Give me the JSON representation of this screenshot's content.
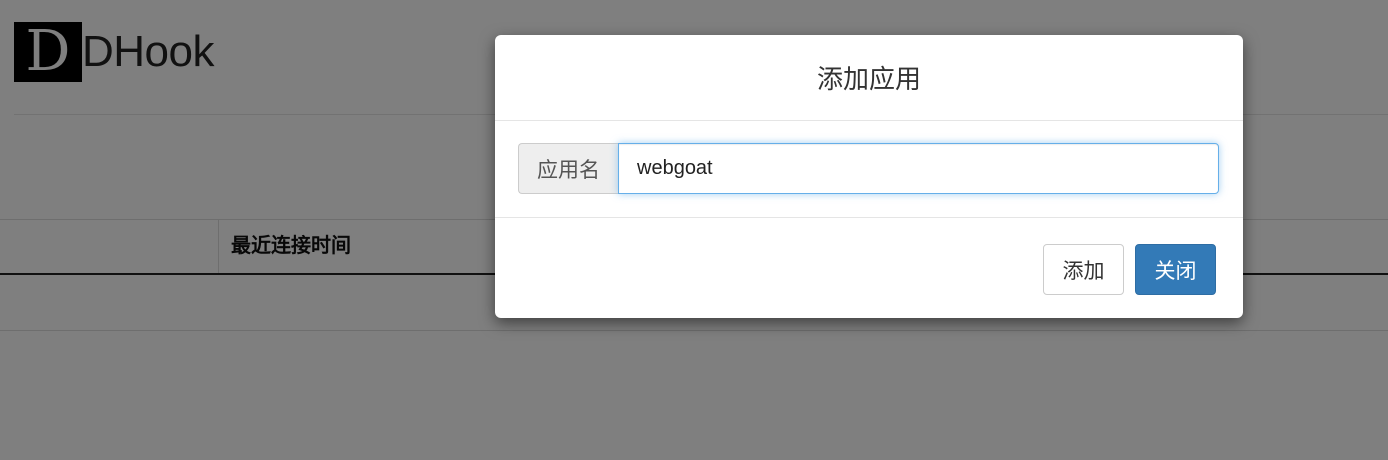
{
  "brand": {
    "logo_letter": "D",
    "name": "DHook"
  },
  "table": {
    "headers": [
      "最近连接时间"
    ]
  },
  "modal": {
    "title": "添加应用",
    "field_label": "应用名",
    "field_value": "webgoat",
    "add_label": "添加",
    "close_label": "关闭"
  },
  "colors": {
    "primary": "#337ab7",
    "backdrop": "#808080"
  }
}
